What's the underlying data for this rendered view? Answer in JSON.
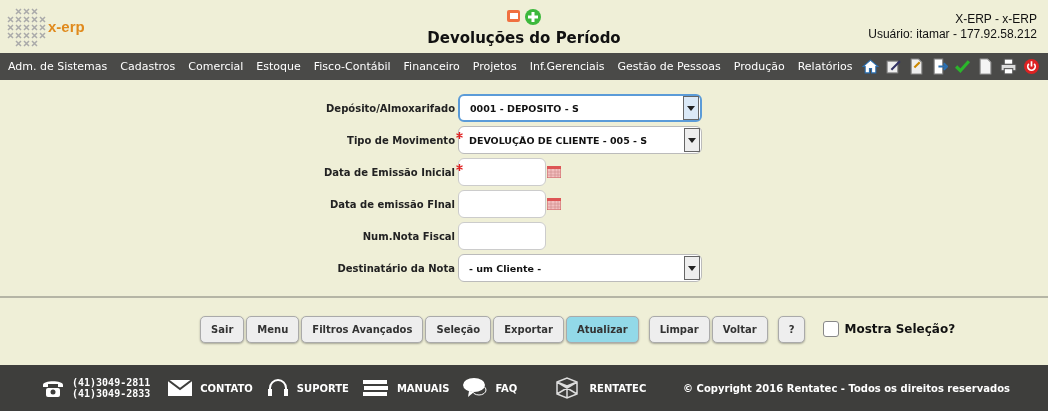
{
  "header": {
    "logo": "x-erp",
    "title": "Devoluções do Período",
    "system": "X-ERP - x-ERP",
    "user": "Usuário: itamar - 177.92.58.212"
  },
  "menu": [
    "Adm. de Sistemas",
    "Cadastros",
    "Comercial",
    "Estoque",
    "Fisco-Contábil",
    "Financeiro",
    "Projetos",
    "Inf.Gerenciais",
    "Gestão de Pessoas",
    "Produção",
    "Relatórios"
  ],
  "form": [
    {
      "label": "Depósito/Almoxarifado",
      "kind": "select",
      "required": false,
      "focused": true,
      "value": "0001 - DEPOSITO - S"
    },
    {
      "label": "Tipo de Movimento",
      "kind": "select",
      "required": true,
      "focused": false,
      "value": "DEVOLUÇÃO DE CLIENTE - 005 - S"
    },
    {
      "label": "Data de Emissão Inicial",
      "kind": "date",
      "required": true
    },
    {
      "label": "Data de emissão FInal",
      "kind": "date",
      "required": false
    },
    {
      "label": "Num.Nota Fiscal",
      "kind": "text",
      "required": false
    },
    {
      "label": "Destinatário da Nota",
      "kind": "select",
      "required": false,
      "focused": false,
      "value": "- um Cliente -"
    }
  ],
  "buttons": [
    {
      "label": "Sair",
      "selected": false
    },
    {
      "label": "Menu",
      "selected": false
    },
    {
      "label": "Filtros Avançados",
      "selected": false
    },
    {
      "label": "Seleção",
      "selected": false
    },
    {
      "label": "Exportar",
      "selected": false
    },
    {
      "label": "Atualizar",
      "selected": true
    },
    {
      "label": "Limpar",
      "selected": false
    },
    {
      "label": "Voltar",
      "selected": false
    },
    {
      "label": "?",
      "selected": false
    }
  ],
  "show_selection": {
    "label": "Mostra Seleção?",
    "checked": false
  },
  "footer": {
    "phones": [
      "(41)3049-2811",
      "(41)3049-2833"
    ],
    "links": [
      {
        "kind": "mail",
        "label": "CONTATO"
      },
      {
        "kind": "headset",
        "label": "SUPORTE"
      },
      {
        "kind": "books",
        "label": "MANUAIS"
      },
      {
        "kind": "faq",
        "label": "FAQ"
      },
      {
        "kind": "cube",
        "label": "RENTATEC"
      }
    ],
    "copyright": "© Copyright 2016 Rentatec - Todos os direitos reservados"
  }
}
